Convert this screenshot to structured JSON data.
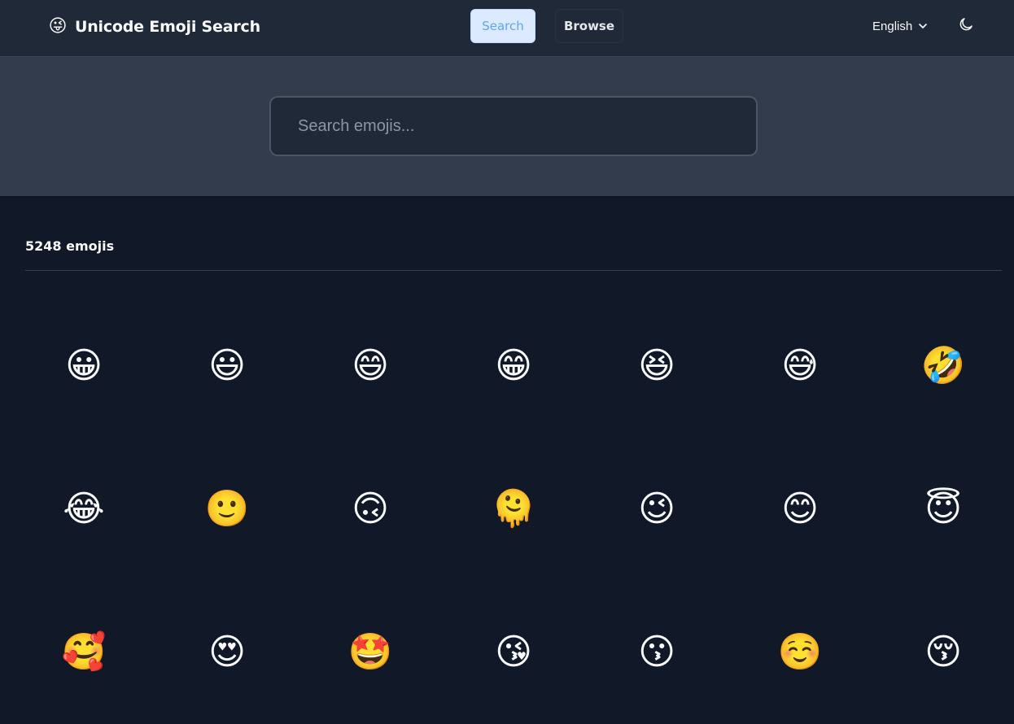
{
  "header": {
    "logo_emoji": "😜",
    "title": "Unicode Emoji Search",
    "nav": {
      "search_label": "Search",
      "browse_label": "Browse"
    },
    "language": "English",
    "theme_icon": "moon-icon"
  },
  "search": {
    "placeholder": "Search emojis...",
    "value": ""
  },
  "results": {
    "count_label": "5248 emojis",
    "emojis": [
      "😀",
      "😃",
      "😄",
      "😁",
      "😆",
      "😅",
      "🤣",
      "😂",
      "🙂",
      "🙃",
      "🫠",
      "😉",
      "😊",
      "😇",
      "🥰",
      "😍",
      "🤩",
      "😘",
      "😗",
      "☺️",
      "😚"
    ]
  },
  "colors": {
    "header_bg": "#1f2937",
    "search_band_bg": "#323c4c",
    "page_bg": "#111827",
    "accent": "#60a5fa",
    "accent_bg": "#dbeafe"
  }
}
